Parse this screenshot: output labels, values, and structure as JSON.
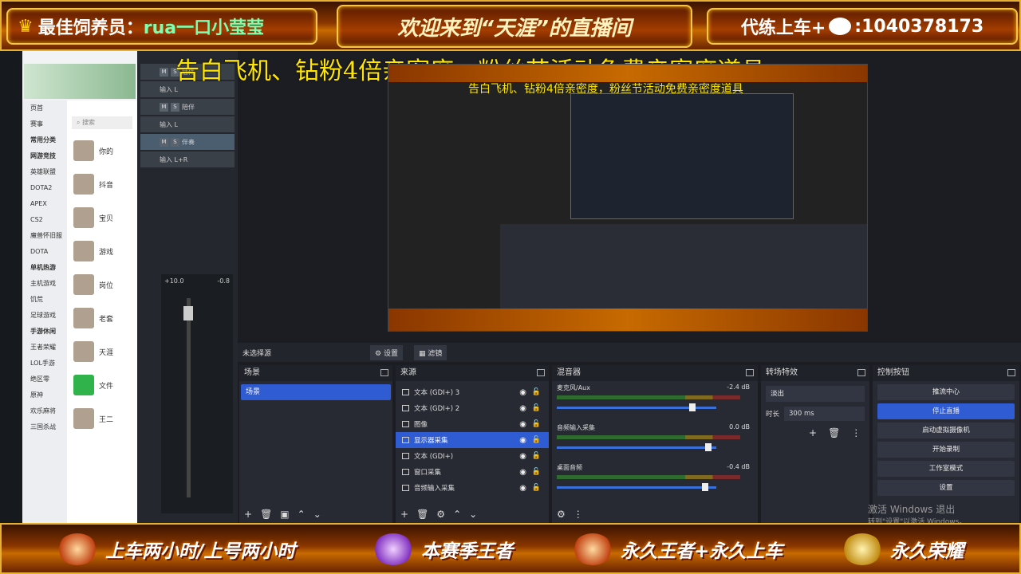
{
  "top": {
    "feeder": "最佳饲养员：",
    "feeder_name": "rua一口小莹莹",
    "welcome": "欢迎来到“天涯”的直播间",
    "train": "代练上车+",
    "train_id": ":1040378173"
  },
  "ticker": "告白飞机、钻粉4倍亲密度，粉丝节活动免费亲密度道具",
  "bottom": {
    "b1": "上车两小时/上号两小时",
    "b2": "本赛季王者",
    "b3": "永久王者+永久上车",
    "b4": "永久荣耀"
  },
  "left": {
    "side_items": [
      "页首",
      "赛事",
      "常用分类",
      "网游竞技",
      "英雄联盟",
      "DOTA2",
      "APEX",
      "CS2",
      "魔兽怀旧服",
      "DOTA",
      "单机热游",
      "主机游戏",
      "饥荒",
      "足球游戏",
      "手游休闲",
      "王者荣耀",
      "LOL手游",
      "绝区零",
      "原神",
      "欢乐麻将",
      "三国杀战"
    ],
    "search_placeholder": "搜索",
    "chat": [
      "你的",
      "抖音",
      "宝贝",
      "游戏",
      "岗位",
      "老套",
      "天涯",
      "文件",
      "王二"
    ]
  },
  "daw": {
    "tracks": [
      "插件",
      "陪伴",
      "伴奏"
    ],
    "inputs": [
      "输入 L",
      "输入 L",
      "输入 L+R"
    ],
    "mixer_vals": [
      "+10.0",
      "-0.8"
    ]
  },
  "obs": {
    "toolbar": {
      "no_scene": "未选择源",
      "settings": "设置",
      "filters": "滤镜"
    },
    "panels": {
      "scenes": "场景",
      "sources": "来源",
      "mixer": "混音器",
      "transitions": "转场特效",
      "controls": "控制按钮"
    },
    "scenes": [
      "场景"
    ],
    "sources": [
      "文本 (GDI+) 3",
      "文本 (GDI+) 2",
      "图像",
      "显示器采集",
      "文本 (GDI+)",
      "窗口采集",
      "音频输入采集"
    ],
    "mixer": [
      {
        "name": "麦克风/Aux",
        "db": "-2.4 dB"
      },
      {
        "name": "音频输入采集",
        "db": "0.0 dB"
      },
      {
        "name": "桌面音频",
        "db": "-0.4 dB"
      }
    ],
    "transition": {
      "value": "淡出",
      "duration_label": "时长",
      "duration": "300 ms"
    },
    "controls": [
      "推流中心",
      "停止直播",
      "启动虚拟摄像机",
      "开始录制",
      "工作室模式",
      "设置"
    ]
  },
  "windows_wm": {
    "line1": "激活 Windows 退出",
    "line2": "转到\"设置\"以激活 Windows。"
  }
}
